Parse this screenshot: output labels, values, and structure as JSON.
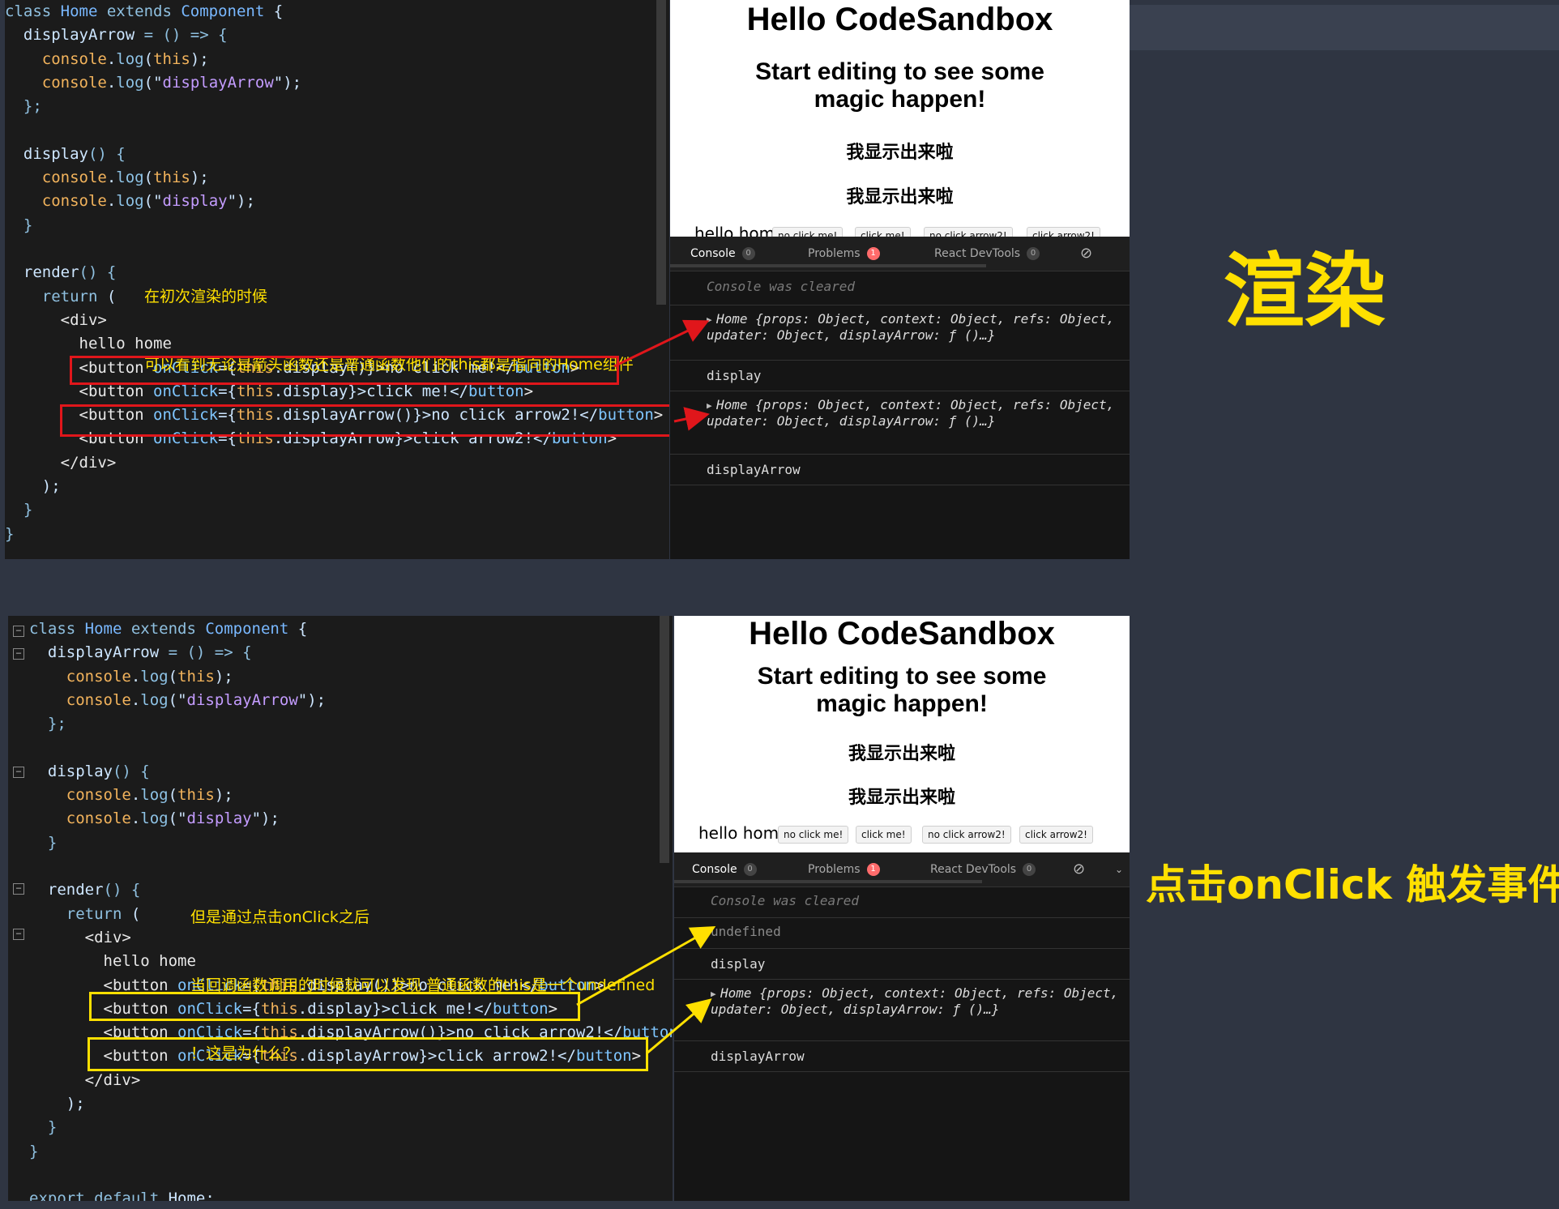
{
  "top_panel": {
    "code": [
      [
        {
          "t": "class ",
          "c": "kw"
        },
        {
          "t": "Home ",
          "c": "cls"
        },
        {
          "t": "extends ",
          "c": "kw"
        },
        {
          "t": "Component ",
          "c": "cls"
        },
        {
          "t": "{",
          "c": "fn"
        }
      ],
      [
        {
          "t": "  displayArrow ",
          "c": "fn"
        },
        {
          "t": "= () => {",
          "c": "kw"
        }
      ],
      [
        {
          "t": "    console",
          "c": "this"
        },
        {
          "t": ".",
          "c": "fn"
        },
        {
          "t": "log",
          "c": "prop"
        },
        {
          "t": "(",
          "c": "fn"
        },
        {
          "t": "this",
          "c": "this"
        },
        {
          "t": ");",
          "c": "fn"
        }
      ],
      [
        {
          "t": "    console",
          "c": "this"
        },
        {
          "t": ".",
          "c": "fn"
        },
        {
          "t": "log",
          "c": "prop"
        },
        {
          "t": "(\"",
          "c": "fn"
        },
        {
          "t": "displayArrow",
          "c": "str"
        },
        {
          "t": "\");",
          "c": "fn"
        }
      ],
      [
        {
          "t": "  };",
          "c": "kw"
        }
      ],
      [],
      [
        {
          "t": "  display",
          "c": "fn"
        },
        {
          "t": "() {",
          "c": "kw"
        }
      ],
      [
        {
          "t": "    console",
          "c": "this"
        },
        {
          "t": ".",
          "c": "fn"
        },
        {
          "t": "log",
          "c": "prop"
        },
        {
          "t": "(",
          "c": "fn"
        },
        {
          "t": "this",
          "c": "this"
        },
        {
          "t": ");",
          "c": "fn"
        }
      ],
      [
        {
          "t": "    console",
          "c": "this"
        },
        {
          "t": ".",
          "c": "fn"
        },
        {
          "t": "log",
          "c": "prop"
        },
        {
          "t": "(\"",
          "c": "fn"
        },
        {
          "t": "display",
          "c": "str"
        },
        {
          "t": "\");",
          "c": "fn"
        }
      ],
      [
        {
          "t": "  }",
          "c": "kw"
        }
      ],
      [],
      [
        {
          "t": "  render",
          "c": "fn"
        },
        {
          "t": "() {",
          "c": "kw"
        }
      ],
      [
        {
          "t": "    return ",
          "c": "kw"
        },
        {
          "t": "(",
          "c": "fn"
        }
      ],
      [
        {
          "t": "      <div>",
          "c": "tag"
        }
      ],
      [
        {
          "t": "        hello home",
          "c": "tag"
        }
      ],
      [
        {
          "t": "        <button ",
          "c": "tag"
        },
        {
          "t": "onClick",
          "c": "attr"
        },
        {
          "t": "={",
          "c": "fn"
        },
        {
          "t": "this",
          "c": "this"
        },
        {
          "t": ".display()}>no click me!</",
          "c": "fn"
        },
        {
          "t": "button",
          "c": "attr"
        },
        {
          "t": ">",
          "c": "tag"
        }
      ],
      [
        {
          "t": "        <button ",
          "c": "tag"
        },
        {
          "t": "onClick",
          "c": "attr"
        },
        {
          "t": "={",
          "c": "fn"
        },
        {
          "t": "this",
          "c": "this"
        },
        {
          "t": ".display}>click me!</",
          "c": "fn"
        },
        {
          "t": "button",
          "c": "attr"
        },
        {
          "t": ">",
          "c": "tag"
        }
      ],
      [
        {
          "t": "        <button ",
          "c": "tag"
        },
        {
          "t": "onClick",
          "c": "attr"
        },
        {
          "t": "={",
          "c": "fn"
        },
        {
          "t": "this",
          "c": "this"
        },
        {
          "t": ".displayArrow()}>no click arrow2!</",
          "c": "fn"
        },
        {
          "t": "button",
          "c": "attr"
        },
        {
          "t": ">",
          "c": "tag"
        }
      ],
      [
        {
          "t": "        <button ",
          "c": "tag"
        },
        {
          "t": "onClick",
          "c": "attr"
        },
        {
          "t": "={",
          "c": "fn"
        },
        {
          "t": "this",
          "c": "this"
        },
        {
          "t": ".displayArrow}>click arrow2!</",
          "c": "fn"
        },
        {
          "t": "button",
          "c": "attr"
        },
        {
          "t": ">",
          "c": "tag"
        }
      ],
      [
        {
          "t": "      </div>",
          "c": "tag"
        }
      ],
      [
        {
          "t": "    );",
          "c": "fn"
        }
      ],
      [
        {
          "t": "  }",
          "c": "kw"
        }
      ],
      [
        {
          "t": "}",
          "c": "kw"
        }
      ]
    ],
    "note_line1": "在初次渲染的时候",
    "note_line2": "可以看到无论是箭头函数还是普通函数他们的this都是指向的Home组件",
    "preview": {
      "title": "Hello CodeSandbox",
      "subtitle": "Start editing to see some magic happen!",
      "line1": "我显示出来啦",
      "line2": "我显示出来啦",
      "hello": "hello home",
      "buttons": [
        "no click me!",
        "click me!",
        "no click arrow2!",
        "click arrow2!"
      ]
    },
    "console": {
      "tabs": {
        "console": "Console",
        "console_count": "0",
        "problems": "Problems",
        "problems_count": "1",
        "devtools": "React DevTools",
        "devtools_count": "0"
      },
      "cleared": "Console was cleared",
      "obj1_line1": "Home {props: Object, context: Object, refs: Object,",
      "obj1_line2": "updater: Object, displayArrow: ƒ ()…}",
      "log1": "display",
      "obj2_line1": "Home {props: Object, context: Object, refs: Object,",
      "obj2_line2": "updater: Object, displayArrow: ƒ ()…}",
      "log2": "displayArrow"
    },
    "label": "渲染"
  },
  "bottom_panel": {
    "code": [
      [
        {
          "t": "class ",
          "c": "kw"
        },
        {
          "t": "Home ",
          "c": "cls"
        },
        {
          "t": "extends ",
          "c": "kw"
        },
        {
          "t": "Component ",
          "c": "cls"
        },
        {
          "t": "{",
          "c": "fn"
        }
      ],
      [
        {
          "t": "  displayArrow ",
          "c": "fn"
        },
        {
          "t": "= () => {",
          "c": "kw"
        }
      ],
      [
        {
          "t": "    console",
          "c": "this"
        },
        {
          "t": ".",
          "c": "fn"
        },
        {
          "t": "log",
          "c": "prop"
        },
        {
          "t": "(",
          "c": "fn"
        },
        {
          "t": "this",
          "c": "this"
        },
        {
          "t": ");",
          "c": "fn"
        }
      ],
      [
        {
          "t": "    console",
          "c": "this"
        },
        {
          "t": ".",
          "c": "fn"
        },
        {
          "t": "log",
          "c": "prop"
        },
        {
          "t": "(\"",
          "c": "fn"
        },
        {
          "t": "displayArrow",
          "c": "str"
        },
        {
          "t": "\");",
          "c": "fn"
        }
      ],
      [
        {
          "t": "  };",
          "c": "kw"
        }
      ],
      [],
      [
        {
          "t": "  display",
          "c": "fn"
        },
        {
          "t": "() {",
          "c": "kw"
        }
      ],
      [
        {
          "t": "    console",
          "c": "this"
        },
        {
          "t": ".",
          "c": "fn"
        },
        {
          "t": "log",
          "c": "prop"
        },
        {
          "t": "(",
          "c": "fn"
        },
        {
          "t": "this",
          "c": "this"
        },
        {
          "t": ");",
          "c": "fn"
        }
      ],
      [
        {
          "t": "    console",
          "c": "this"
        },
        {
          "t": ".",
          "c": "fn"
        },
        {
          "t": "log",
          "c": "prop"
        },
        {
          "t": "(\"",
          "c": "fn"
        },
        {
          "t": "display",
          "c": "str"
        },
        {
          "t": "\");",
          "c": "fn"
        }
      ],
      [
        {
          "t": "  }",
          "c": "kw"
        }
      ],
      [],
      [
        {
          "t": "  render",
          "c": "fn"
        },
        {
          "t": "() {",
          "c": "kw"
        }
      ],
      [
        {
          "t": "    return ",
          "c": "kw"
        },
        {
          "t": "(",
          "c": "fn"
        }
      ],
      [
        {
          "t": "      <div>",
          "c": "tag"
        }
      ],
      [
        {
          "t": "        hello home",
          "c": "tag"
        }
      ],
      [
        {
          "t": "        <button ",
          "c": "tag"
        },
        {
          "t": "onClick",
          "c": "attr"
        },
        {
          "t": "={",
          "c": "fn"
        },
        {
          "t": "this",
          "c": "this"
        },
        {
          "t": ".display()}>no click me!</",
          "c": "fn"
        },
        {
          "t": "button",
          "c": "attr"
        },
        {
          "t": ">",
          "c": "tag"
        }
      ],
      [
        {
          "t": "        <button ",
          "c": "tag"
        },
        {
          "t": "onClick",
          "c": "attr"
        },
        {
          "t": "={",
          "c": "fn"
        },
        {
          "t": "this",
          "c": "this"
        },
        {
          "t": ".display}>click me!</",
          "c": "fn"
        },
        {
          "t": "button",
          "c": "attr"
        },
        {
          "t": ">",
          "c": "tag"
        }
      ],
      [
        {
          "t": "        <button ",
          "c": "tag"
        },
        {
          "t": "onClick",
          "c": "attr"
        },
        {
          "t": "={",
          "c": "fn"
        },
        {
          "t": "this",
          "c": "this"
        },
        {
          "t": ".displayArrow()}>no click arrow2!</",
          "c": "fn"
        },
        {
          "t": "button",
          "c": "attr"
        },
        {
          "t": ">",
          "c": "tag"
        }
      ],
      [
        {
          "t": "        <button ",
          "c": "tag"
        },
        {
          "t": "onClick",
          "c": "attr"
        },
        {
          "t": "={",
          "c": "fn"
        },
        {
          "t": "this",
          "c": "this"
        },
        {
          "t": ".displayArrow}>click arrow2!</",
          "c": "fn"
        },
        {
          "t": "button",
          "c": "attr"
        },
        {
          "t": ">",
          "c": "tag"
        }
      ],
      [
        {
          "t": "      </div>",
          "c": "tag"
        }
      ],
      [
        {
          "t": "    );",
          "c": "fn"
        }
      ],
      [
        {
          "t": "  }",
          "c": "kw"
        }
      ],
      [
        {
          "t": "}",
          "c": "kw"
        }
      ],
      [],
      [
        {
          "t": "export default ",
          "c": "kw"
        },
        {
          "t": "Home;",
          "c": "fn"
        }
      ]
    ],
    "note_line1": "但是通过点击onClick之后",
    "note_line2": "当回调函数调用的时候就可以发现 普通函数的this是一个undefined",
    "note_line3": "！这是为什么？",
    "preview": {
      "title": "Hello CodeSandbox",
      "subtitle": "Start editing to see some magic happen!",
      "line1": "我显示出来啦",
      "line2": "我显示出来啦",
      "hello": "hello home",
      "buttons": [
        "no click me!",
        "click me!",
        "no click arrow2!",
        "click arrow2!"
      ]
    },
    "console": {
      "tabs": {
        "console": "Console",
        "console_count": "0",
        "problems": "Problems",
        "problems_count": "1",
        "devtools": "React DevTools",
        "devtools_count": "0"
      },
      "cleared": "Console was cleared",
      "undefined": "undefined",
      "log1": "display",
      "obj_line1": "Home {props: Object, context: Object, refs: Object,",
      "obj_line2": "updater: Object, displayArrow: ƒ ()…}",
      "log2": "displayArrow"
    },
    "label": "点击onClick 触发事件"
  },
  "colors": {
    "annotation_yellow": "#ffe000",
    "highlight_red": "#e0161b",
    "badge_red": "#ff6b6b"
  }
}
